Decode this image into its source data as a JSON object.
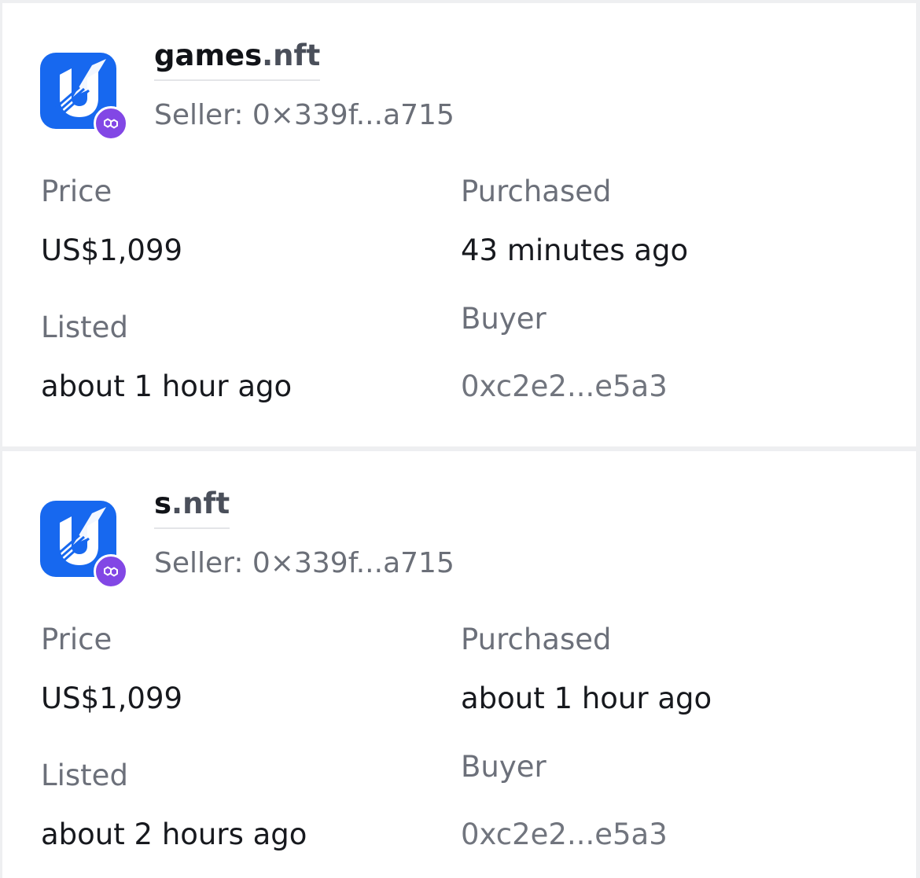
{
  "sales": [
    {
      "domain": {
        "name": "games",
        "extension": ".nft"
      },
      "seller_label": "Seller:",
      "seller_address": "0×339f...a715",
      "logo_icon": "unstoppable-domains-logo-icon",
      "chain_icon": "polygon-icon",
      "price_label": "Price",
      "price_value": "US$1,099",
      "purchased_label": "Purchased",
      "purchased_value": "43 minutes ago",
      "listed_label": "Listed",
      "listed_value": "about 1 hour ago",
      "buyer_label": "Buyer",
      "buyer_value": "0xc2e2...e5a3"
    },
    {
      "domain": {
        "name": "s",
        "extension": ".nft"
      },
      "seller_label": "Seller:",
      "seller_address": "0×339f...a715",
      "logo_icon": "unstoppable-domains-logo-icon",
      "chain_icon": "polygon-icon",
      "price_label": "Price",
      "price_value": "US$1,099",
      "purchased_label": "Purchased",
      "purchased_value": "about 1 hour ago",
      "listed_label": "Listed",
      "listed_value": "about 2 hours ago",
      "buyer_label": "Buyer",
      "buyer_value": "0xc2e2...e5a3"
    }
  ],
  "colors": {
    "logo_background": "#1768ef",
    "chain_badge": "#8247e5",
    "card_background": "#ffffff",
    "page_background": "#eeeff1"
  }
}
